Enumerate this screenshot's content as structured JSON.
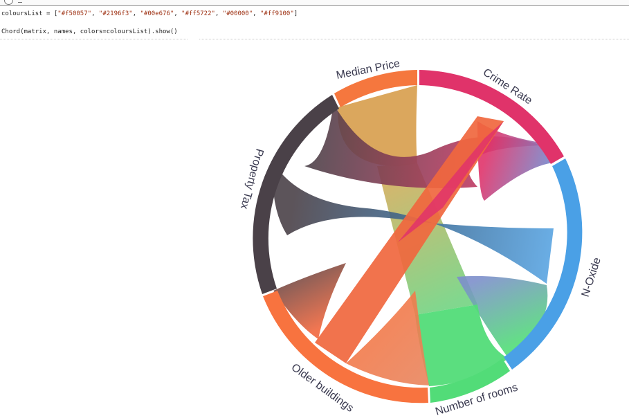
{
  "code_lines": {
    "line1_prefix": "coloursList = [",
    "line1_items": [
      "\"#f50057\"",
      "\"#2196f3\"",
      "\"#00e676\"",
      "\"#ff5722\"",
      "\"#00000\"",
      "\"#ff9100\""
    ],
    "line1_suffix": "]",
    "line2": "Chord(matrix, names, colors=coloursList).show()"
  },
  "chart_data": {
    "type": "chord",
    "names": [
      "Crime Rate",
      "N-Oxide",
      "Number of rooms",
      "Older buildings",
      "Property Tax",
      "Median Price"
    ],
    "colors": [
      "#e0336a",
      "#4aa0e6",
      "#52dc78",
      "#f8733f",
      "#4a4148",
      "#f5773e"
    ]
  }
}
